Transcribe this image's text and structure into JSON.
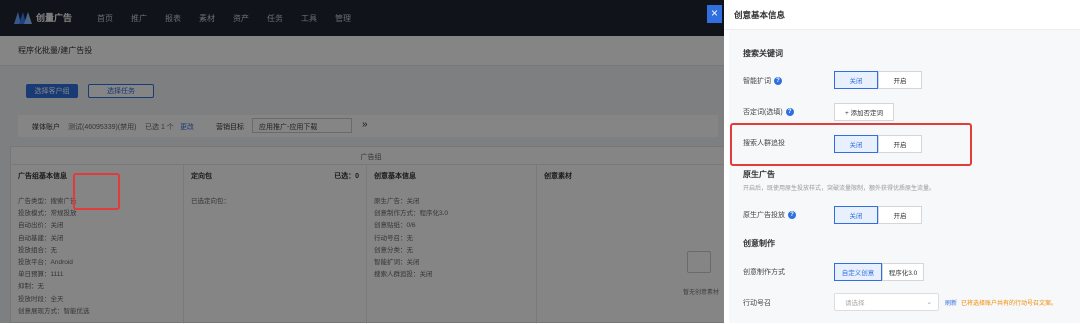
{
  "brand": {
    "name": "创量广告"
  },
  "nav": [
    "首页",
    "推广",
    "报表",
    "素材",
    "资产",
    "任务",
    "工具",
    "管理"
  ],
  "breadcrumb": "程序化批量/建广告投",
  "buttons": {
    "select_account": "选择客户组",
    "select_task": "选择任务"
  },
  "filter": {
    "media_label": "媒体账户",
    "media_value": "测试(46095339)(禁用)",
    "selected": "已选 1 个",
    "change": "更改",
    "goal_label": "营销目标",
    "goal_value": "应用推广-应用下载",
    "expand": "»"
  },
  "table": {
    "group_title": "广告组",
    "col1": {
      "header": "广告组基本信息",
      "rows": [
        "广告类型：搜索广告",
        "投放模式：常规投放",
        "自动出价：关闭",
        "自动基建：关闭",
        "投放组合：无",
        "投放平台：Android",
        "单日预算：1111",
        "抑制：无",
        "投放时段：全天",
        "创意展现方式：智能优选"
      ]
    },
    "col2": {
      "header": "定向包",
      "count": "已选：0",
      "rows": [
        "已选定向包："
      ]
    },
    "col3": {
      "header": "创意基本信息",
      "rows": [
        "原生广告：关闭",
        "创意制作方式：程序化3.0",
        "创意贴纸：0/6",
        "行动号召：无",
        "创意分类：无",
        "智能扩词：关闭",
        "搜索人群追投：关闭"
      ]
    },
    "col4": {
      "header": "创意素材",
      "empty": "暂无创意素材"
    }
  },
  "drawer": {
    "title": "创意基本信息",
    "close_icon": "×",
    "search_section": "搜索关键词",
    "smart_expand": {
      "label": "智能扩词",
      "off": "关闭",
      "on": "开启"
    },
    "negative_words": {
      "label": "否定词(选填)",
      "button": "+ 添加否定词"
    },
    "search_crowd": {
      "label": "搜索人群追投",
      "off": "关闭",
      "on": "开启"
    },
    "native_section": "原生广告",
    "native_hint": "开启后，既使用原生投放样式，突破流量限制，额外获得优质原生流量。",
    "native_ad": {
      "label": "原生广告投放",
      "off": "关闭",
      "on": "开启"
    },
    "creative_section": "创意制作",
    "creative_method": {
      "label": "创意制作方式",
      "custom": "自定义创意",
      "program": "程序化3.0"
    },
    "cta": {
      "label": "行动号召",
      "placeholder": "请选择",
      "refresh": "刷新",
      "warn": "已将选择账户共有的行动号召文案。"
    }
  },
  "colors": {
    "accent": "#2f6fe0",
    "highlight": "#e23b3b",
    "nav_bg": "#1f2633"
  }
}
